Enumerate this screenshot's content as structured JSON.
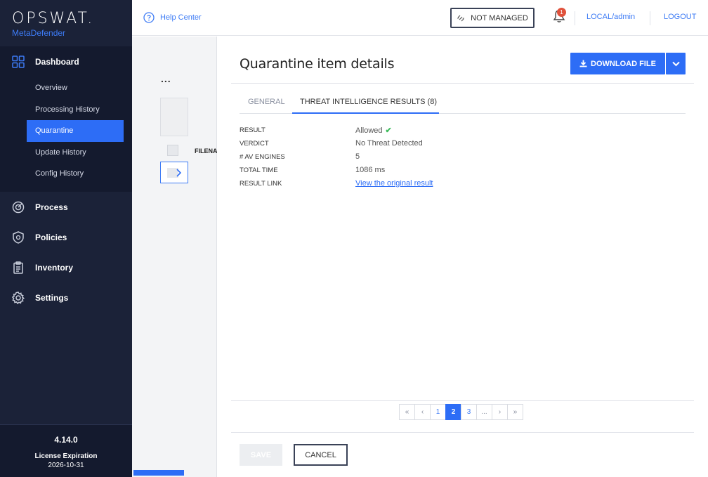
{
  "brand": {
    "name": "OPSWAT.",
    "product": "MetaDefender"
  },
  "sidebar": {
    "dashboard": {
      "label": "Dashboard",
      "items": [
        {
          "label": "Overview"
        },
        {
          "label": "Processing History"
        },
        {
          "label": "Quarantine"
        },
        {
          "label": "Update History"
        },
        {
          "label": "Config History"
        }
      ]
    },
    "items": [
      {
        "label": "Process",
        "icon": "target-icon"
      },
      {
        "label": "Policies",
        "icon": "shield-icon"
      },
      {
        "label": "Inventory",
        "icon": "clipboard-icon"
      },
      {
        "label": "Settings",
        "icon": "gear-icon"
      }
    ],
    "footer": {
      "version": "4.14.0",
      "license_label": "License Expiration",
      "license_date": "2026-10-31"
    }
  },
  "topbar": {
    "help": "Help Center",
    "not_managed": "NOT MANAGED",
    "notifications_count": "1",
    "user": "LOCAL/admin",
    "logout": "LOGOUT"
  },
  "background_list": {
    "more": "...",
    "filename_header": "FILENAME"
  },
  "panel": {
    "title": "Quarantine item details",
    "download": "DOWNLOAD FILE",
    "tabs": {
      "general": "GENERAL",
      "threat": "THREAT INTELLIGENCE RESULTS (8)"
    },
    "rows": [
      {
        "key": "RESULT",
        "value": "Allowed"
      },
      {
        "key": "VERDICT",
        "value": "No Threat Detected"
      },
      {
        "key": "# AV ENGINES",
        "value": "5"
      },
      {
        "key": "TOTAL TIME",
        "value": "1086 ms"
      },
      {
        "key": "RESULT LINK",
        "value": "View the original result"
      }
    ],
    "pager": [
      "«",
      "‹",
      "1",
      "2",
      "3",
      "...",
      "›",
      "»"
    ],
    "save": "SAVE",
    "cancel": "CANCEL"
  },
  "colors": {
    "accent": "#2d6df6",
    "sidebar": "#1b2238",
    "success": "#3dbb5b"
  }
}
